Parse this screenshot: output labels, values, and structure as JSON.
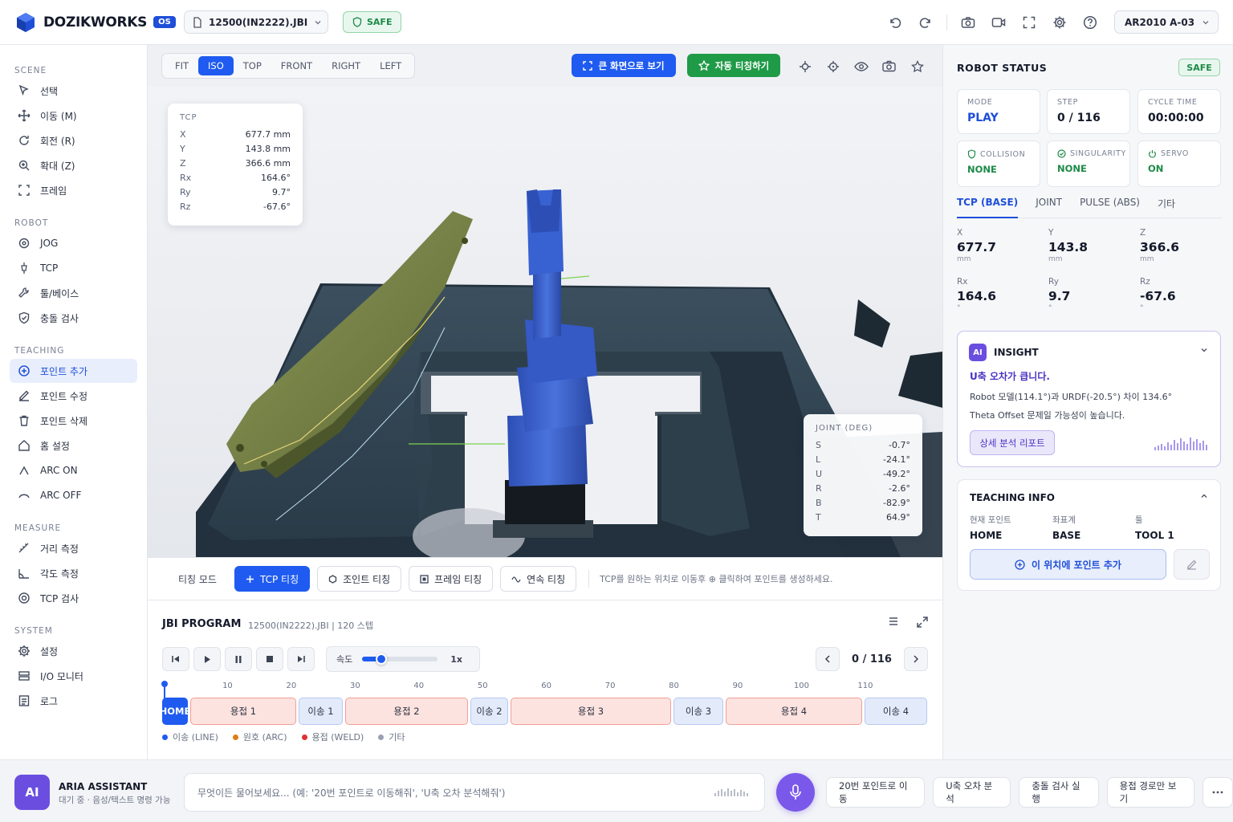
{
  "app": {
    "name": "DOZIKWORKS",
    "version": "OS"
  },
  "header": {
    "file": "12500(IN2222).JBI",
    "safe": "SAFE",
    "robot": "AR2010 A-03",
    "icons": [
      "undo-icon",
      "redo-icon",
      "camera-icon",
      "video-icon",
      "fullscreen-icon",
      "gear-icon",
      "help-icon"
    ]
  },
  "sidebar": {
    "sections": [
      {
        "title": "SCENE",
        "items": [
          {
            "label": "선택",
            "icon": "cursor-icon"
          },
          {
            "label": "이동 (M)",
            "icon": "move-icon"
          },
          {
            "label": "회전 (R)",
            "icon": "rotate-icon"
          },
          {
            "label": "확대 (Z)",
            "icon": "zoom-icon"
          },
          {
            "label": "프레임",
            "icon": "frame-icon"
          }
        ]
      },
      {
        "title": "ROBOT",
        "items": [
          {
            "label": "JOG",
            "icon": "jog-icon"
          },
          {
            "label": "TCP",
            "icon": "tcp-icon"
          },
          {
            "label": "툴/베이스",
            "icon": "wrench-icon"
          },
          {
            "label": "충돌 검사",
            "icon": "shield-icon"
          }
        ]
      },
      {
        "title": "TEACHING",
        "items": [
          {
            "label": "포인트 추가",
            "icon": "plus-circle-icon",
            "active": true
          },
          {
            "label": "포인트 수정",
            "icon": "edit-icon"
          },
          {
            "label": "포인트 삭제",
            "icon": "trash-icon"
          },
          {
            "label": "홈 설정",
            "icon": "home-icon"
          },
          {
            "label": "ARC ON",
            "icon": "arc-on-icon"
          },
          {
            "label": "ARC OFF",
            "icon": "arc-off-icon"
          }
        ]
      },
      {
        "title": "MEASURE",
        "items": [
          {
            "label": "거리 측정",
            "icon": "ruler-icon"
          },
          {
            "label": "각도 측정",
            "icon": "angle-icon"
          },
          {
            "label": "TCP 검사",
            "icon": "target-icon"
          }
        ]
      },
      {
        "title": "SYSTEM",
        "items": [
          {
            "label": "설정",
            "icon": "gear-icon"
          },
          {
            "label": "I/O 모니터",
            "icon": "io-icon"
          },
          {
            "label": "로그",
            "icon": "log-icon"
          }
        ]
      }
    ]
  },
  "viewport": {
    "views": [
      "FIT",
      "ISO",
      "TOP",
      "FRONT",
      "RIGHT",
      "LEFT"
    ],
    "active_view": "ISO",
    "fullscreen_label": "큰 화면으로 보기",
    "auto_teach_label": "자동 티칭하기",
    "tcp_card": {
      "title": "TCP",
      "rows": [
        {
          "k": "X",
          "v": "677.7 mm"
        },
        {
          "k": "Y",
          "v": "143.8 mm"
        },
        {
          "k": "Z",
          "v": "366.6 mm"
        },
        {
          "k": "Rx",
          "v": "164.6°"
        },
        {
          "k": "Ry",
          "v": "9.7°"
        },
        {
          "k": "Rz",
          "v": "-67.6°"
        }
      ]
    },
    "joint_card": {
      "title": "JOINT (DEG)",
      "rows": [
        {
          "k": "S",
          "v": "-0.7°"
        },
        {
          "k": "L",
          "v": "-24.1°"
        },
        {
          "k": "U",
          "v": "-49.2°"
        },
        {
          "k": "R",
          "v": "-2.6°"
        },
        {
          "k": "B",
          "v": "-82.9°"
        },
        {
          "k": "T",
          "v": "64.9°"
        }
      ]
    }
  },
  "teach_bar": {
    "mode_label": "티칭 모드",
    "buttons": [
      "TCP 티칭",
      "조인트 티칭",
      "프레임 티칭",
      "연속 티칭"
    ],
    "active": "TCP 티칭",
    "hint": "TCP를 원하는 위치로 이동후 ⊕ 클릭하여 포인트를 생성하세요."
  },
  "program": {
    "title": "JBI PROGRAM",
    "subtitle": "12500(IN2222).JBI | 120 스텝",
    "speed_label": "속도",
    "speed_value": "1x",
    "speed_fraction": 0.25,
    "page": "0 / 116",
    "ticks": [
      "10",
      "20",
      "30",
      "40",
      "50",
      "60",
      "70",
      "80",
      "90",
      "100",
      "110"
    ],
    "segments": [
      {
        "label": "HOME",
        "type": "home"
      },
      {
        "label": "용접 1",
        "type": "weld"
      },
      {
        "label": "이송 1",
        "type": "move"
      },
      {
        "label": "용접 2",
        "type": "weld"
      },
      {
        "label": "이송 2",
        "type": "move"
      },
      {
        "label": "용접 3",
        "type": "weld"
      },
      {
        "label": "이송 3",
        "type": "move"
      },
      {
        "label": "용접 4",
        "type": "weld"
      },
      {
        "label": "이송 4",
        "type": "move"
      }
    ],
    "legend": [
      {
        "label": "이송 (LINE)",
        "color": "#1f5bf0"
      },
      {
        "label": "원호 (ARC)",
        "color": "#e07d12"
      },
      {
        "label": "용접 (WELD)",
        "color": "#e03131"
      },
      {
        "label": "기타",
        "color": "#9aa0b0"
      }
    ]
  },
  "robot_status": {
    "title": "ROBOT STATUS",
    "safe": "SAFE",
    "stats": [
      {
        "label": "MODE",
        "value": "PLAY"
      },
      {
        "label": "STEP",
        "value": "0 / 116"
      },
      {
        "label": "CYCLE TIME",
        "value": "00:00:00"
      }
    ],
    "checks": [
      {
        "label": "COLLISION",
        "value": "NONE",
        "icon": "shield-check-icon"
      },
      {
        "label": "SINGULARITY",
        "value": "NONE",
        "icon": "check-circle-icon"
      },
      {
        "label": "SERVO",
        "value": "ON",
        "icon": "power-icon"
      }
    ],
    "tabs": [
      "TCP (BASE)",
      "JOINT",
      "PULSE (ABS)",
      "기타"
    ],
    "active_tab": "TCP (BASE)",
    "coords": [
      {
        "label": "X",
        "value": "677.7",
        "unit": "mm"
      },
      {
        "label": "Y",
        "value": "143.8",
        "unit": "mm"
      },
      {
        "label": "Z",
        "value": "366.6",
        "unit": "mm"
      },
      {
        "label": "Rx",
        "value": "164.6",
        "unit": "°"
      },
      {
        "label": "Ry",
        "value": "9.7",
        "unit": "°"
      },
      {
        "label": "Rz",
        "value": "-67.6",
        "unit": "°"
      }
    ]
  },
  "insight": {
    "badge": "AI",
    "title": "INSIGHT",
    "headline": "U축 오차가 큽니다.",
    "line1": "Robot 모델(114.1°)과 URDF(-20.5°) 차이 134.6°",
    "line2": "Theta Offset 문제일 가능성이 높습니다.",
    "button": "상세 분석 리포트"
  },
  "teaching_info": {
    "title": "TEACHING INFO",
    "cols": [
      {
        "label": "현재 포인트",
        "value": "HOME"
      },
      {
        "label": "좌표계",
        "value": "BASE"
      },
      {
        "label": "툴",
        "value": "TOOL 1"
      }
    ],
    "add_button": "이 위치에 포인트 추가"
  },
  "assistant": {
    "badge": "AI",
    "title": "ARIA ASSISTANT",
    "subtitle": "대기 중 · 음성/텍스트 명령 가능",
    "placeholder": "무엇이든 물어보세요... (예: '20번 포인트로 이동해줘', 'U축 오차 분석해줘')",
    "chips": [
      "20번 포인트로 이동",
      "U축 오차 분석",
      "충돌 검사 실행",
      "용접 경로만 보기"
    ]
  }
}
